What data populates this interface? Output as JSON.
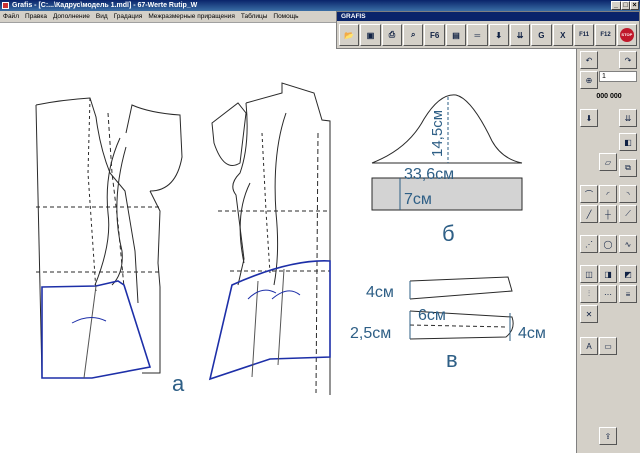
{
  "window": {
    "title": "Grafis - [C:...\\Кадрус\\модель 1.mdl] - 67-Werte Rutip_W",
    "minimize": "_",
    "maximize": "□",
    "close": "×"
  },
  "menu": [
    "Файл",
    "Правка",
    "Дополнение",
    "Вид",
    "Градация",
    "Межразмерные приращения",
    "Таблицы",
    "Помощь"
  ],
  "toolbar": {
    "title": "GRAFIS",
    "buttons": [
      {
        "icon": "open-folder-icon",
        "label": ""
      },
      {
        "icon": "save-icon",
        "label": ""
      },
      {
        "icon": "print-icon",
        "label": ""
      },
      {
        "icon": "magnifier-icon",
        "label": ""
      },
      {
        "icon": "f6-icon",
        "label": "F6"
      },
      {
        "icon": "page-icon",
        "label": ""
      },
      {
        "icon": "measure-icon",
        "label": ""
      },
      {
        "icon": "download-arrow-icon",
        "label": ""
      },
      {
        "icon": "download-stack-icon",
        "label": ""
      },
      {
        "icon": "g-letter-icon",
        "label": "G"
      },
      {
        "icon": "x-letter-icon",
        "label": "X"
      },
      {
        "icon": "f11-icon",
        "label": "F11"
      },
      {
        "icon": "f12-icon",
        "label": "F12"
      },
      {
        "icon": "stop-icon",
        "label": "STOP"
      }
    ]
  },
  "side_panel": {
    "zoom_value": "1",
    "counter": "000 000"
  },
  "drawing": {
    "labels": {
      "a": "а",
      "b": "б",
      "v": "в",
      "sleeve_height": "14,5см",
      "sleeve_width": "33,6см",
      "cuff_height": "7см",
      "collar_top": "4см",
      "collar_mid": "6см",
      "collar_bottom": "2,5см",
      "collar_right": "4см"
    },
    "colors": {
      "outline": "#2a2a2a",
      "blue": "#1d2fa8",
      "label": "#2e5f86",
      "fill": "#d3d3d3"
    }
  }
}
